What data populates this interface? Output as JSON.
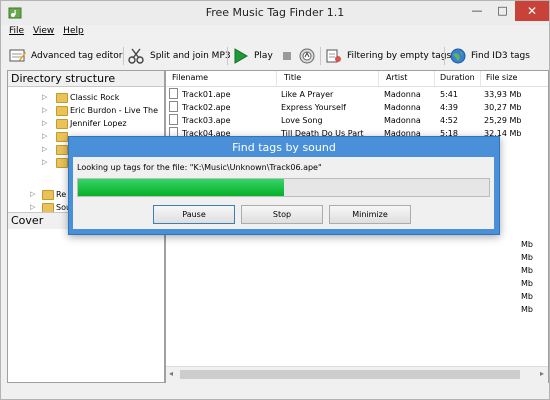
{
  "window": {
    "title": "Free Music Tag Finder 1.1",
    "minimize": "—",
    "maximize": "□",
    "close": "✕"
  },
  "menu": {
    "file": "File",
    "view": "View",
    "help": "Help"
  },
  "toolbar": {
    "advanced_tag_editor": "Advanced tag editor",
    "split_and_join": "Split and join MP3",
    "play": "Play",
    "filtering": "Filtering by empty tags",
    "find_id3": "Find ID3 tags"
  },
  "left": {
    "directory_header": "Directory structure",
    "cover_header": "Cover",
    "tree": [
      "Classic Rock",
      "Eric Burdon - Live The",
      "Jennifer Lopez",
      "Re",
      "Sou"
    ]
  },
  "table": {
    "columns": [
      "Filename",
      "Title",
      "Artist",
      "Duration",
      "File size"
    ],
    "rows": [
      [
        "Track01.ape",
        "Like A Prayer",
        "Madonna",
        "5:41",
        "33,93 Mb"
      ],
      [
        "Track02.ape",
        "Express Yourself",
        "Madonna",
        "4:39",
        "30,27 Mb"
      ],
      [
        "Track03.ape",
        "Love Song",
        "Madonna",
        "4:52",
        "25,29 Mb"
      ],
      [
        "Track04.ape",
        "Till Death Do Us Part",
        "Madonna",
        "5:18",
        "32,14 Mb"
      ]
    ],
    "partial_sizes": [
      "Mb",
      "Mb",
      "Mb",
      "Mb",
      "Mb",
      "Mb"
    ]
  },
  "dialog": {
    "title": "Find tags by sound",
    "message": "Looking up tags for the file: \"K:\\Music\\Unknown\\Track06.ape\"",
    "progress": 0.5,
    "pause": "Pause",
    "stop": "Stop",
    "minimize": "Minimize"
  },
  "colors": {
    "accent": "#4a90d9",
    "progress": "#06b025",
    "close": "#c84238"
  }
}
